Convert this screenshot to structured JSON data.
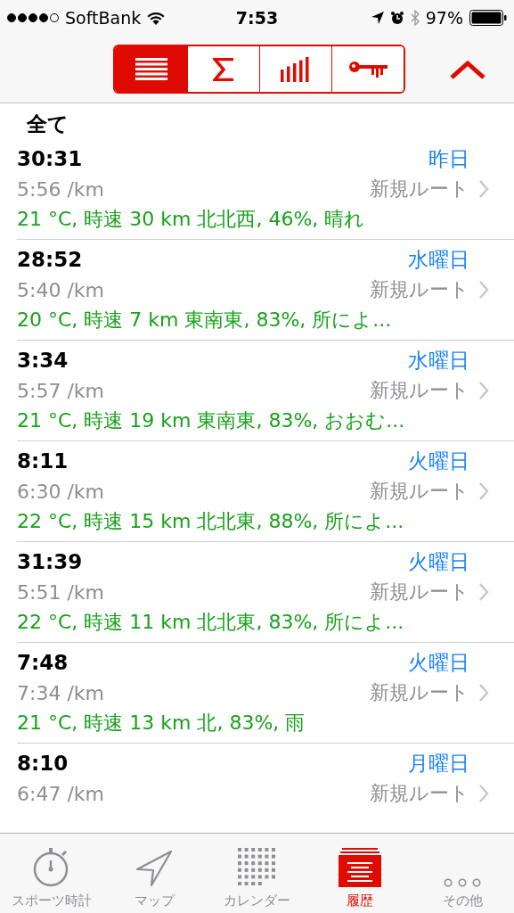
{
  "status_bar": {
    "carrier": "SoftBank",
    "time": "7:53",
    "battery": "97%"
  },
  "segments": [
    {
      "kind": "list",
      "selected": true
    },
    {
      "kind": "sum",
      "selected": false
    },
    {
      "kind": "bars",
      "selected": false
    },
    {
      "kind": "key",
      "selected": false
    }
  ],
  "section_title": "全て",
  "runs": [
    {
      "duration": "30:31",
      "day": "昨日",
      "pace": "5:56 /km",
      "route": "新規ルート",
      "weather": "21 °C, 時速 30 km 北北西, 46%, 晴れ"
    },
    {
      "duration": "28:52",
      "day": "水曜日",
      "pace": "5:40 /km",
      "route": "新規ルート",
      "weather": "20 °C, 時速 7 km 東南東, 83%, 所によ..."
    },
    {
      "duration": "3:34",
      "day": "水曜日",
      "pace": "5:57 /km",
      "route": "新規ルート",
      "weather": "21 °C, 時速 19 km 東南東, 83%, おおむ..."
    },
    {
      "duration": "8:11",
      "day": "火曜日",
      "pace": "6:30 /km",
      "route": "新規ルート",
      "weather": "22 °C, 時速 15 km 北北東, 88%, 所によ..."
    },
    {
      "duration": "31:39",
      "day": "火曜日",
      "pace": "5:51 /km",
      "route": "新規ルート",
      "weather": "22 °C, 時速 11 km 北北東, 83%, 所によ..."
    },
    {
      "duration": "7:48",
      "day": "火曜日",
      "pace": "7:34 /km",
      "route": "新規ルート",
      "weather": "21 °C, 時速 13 km 北, 83%, 雨"
    },
    {
      "duration": "8:10",
      "day": "月曜日",
      "pace": "6:47 /km",
      "route": "新規ルート"
    }
  ],
  "tab_bar": [
    {
      "kind": "stopwatch",
      "label": "スポーツ時計",
      "selected": false
    },
    {
      "kind": "map",
      "label": "マップ",
      "selected": false
    },
    {
      "kind": "calendar",
      "label": "カレンダー",
      "selected": false
    },
    {
      "kind": "history",
      "label": "履歴",
      "selected": true
    },
    {
      "kind": "more",
      "label": "その他",
      "selected": false
    }
  ]
}
